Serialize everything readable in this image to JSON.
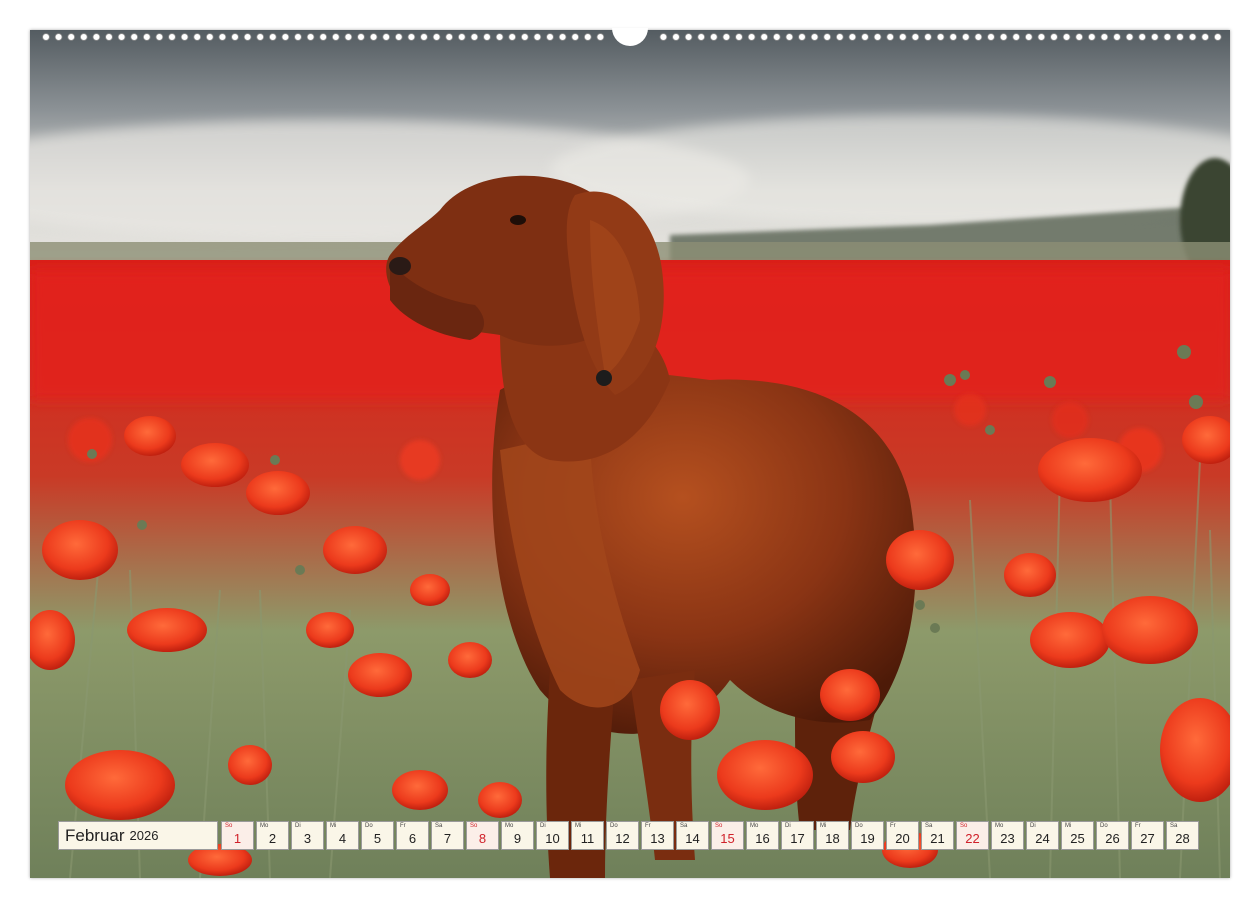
{
  "calendar": {
    "month": "Februar",
    "year": "2026",
    "days": [
      {
        "dow": "So",
        "num": "1",
        "sunday": true
      },
      {
        "dow": "Mo",
        "num": "2",
        "sunday": false
      },
      {
        "dow": "Di",
        "num": "3",
        "sunday": false
      },
      {
        "dow": "Mi",
        "num": "4",
        "sunday": false
      },
      {
        "dow": "Do",
        "num": "5",
        "sunday": false
      },
      {
        "dow": "Fr",
        "num": "6",
        "sunday": false
      },
      {
        "dow": "Sa",
        "num": "7",
        "sunday": false
      },
      {
        "dow": "So",
        "num": "8",
        "sunday": true
      },
      {
        "dow": "Mo",
        "num": "9",
        "sunday": false
      },
      {
        "dow": "Di",
        "num": "10",
        "sunday": false
      },
      {
        "dow": "Mi",
        "num": "11",
        "sunday": false
      },
      {
        "dow": "Do",
        "num": "12",
        "sunday": false
      },
      {
        "dow": "Fr",
        "num": "13",
        "sunday": false
      },
      {
        "dow": "Sa",
        "num": "14",
        "sunday": false
      },
      {
        "dow": "So",
        "num": "15",
        "sunday": true
      },
      {
        "dow": "Mo",
        "num": "16",
        "sunday": false
      },
      {
        "dow": "Di",
        "num": "17",
        "sunday": false
      },
      {
        "dow": "Mi",
        "num": "18",
        "sunday": false
      },
      {
        "dow": "Do",
        "num": "19",
        "sunday": false
      },
      {
        "dow": "Fr",
        "num": "20",
        "sunday": false
      },
      {
        "dow": "Sa",
        "num": "21",
        "sunday": false
      },
      {
        "dow": "So",
        "num": "22",
        "sunday": true
      },
      {
        "dow": "Mo",
        "num": "23",
        "sunday": false
      },
      {
        "dow": "Di",
        "num": "24",
        "sunday": false
      },
      {
        "dow": "Mi",
        "num": "25",
        "sunday": false
      },
      {
        "dow": "Do",
        "num": "26",
        "sunday": false
      },
      {
        "dow": "Fr",
        "num": "27",
        "sunday": false
      },
      {
        "dow": "Sa",
        "num": "28",
        "sunday": false
      }
    ]
  },
  "colors": {
    "sunday_red": "#d0202a",
    "cell_bg": "#faf6e8",
    "poppy_red": "#e4261e",
    "setter_coat": "#8a3414"
  },
  "photo": {
    "subject": "dog-icon",
    "scene": "poppy-field-icon"
  }
}
